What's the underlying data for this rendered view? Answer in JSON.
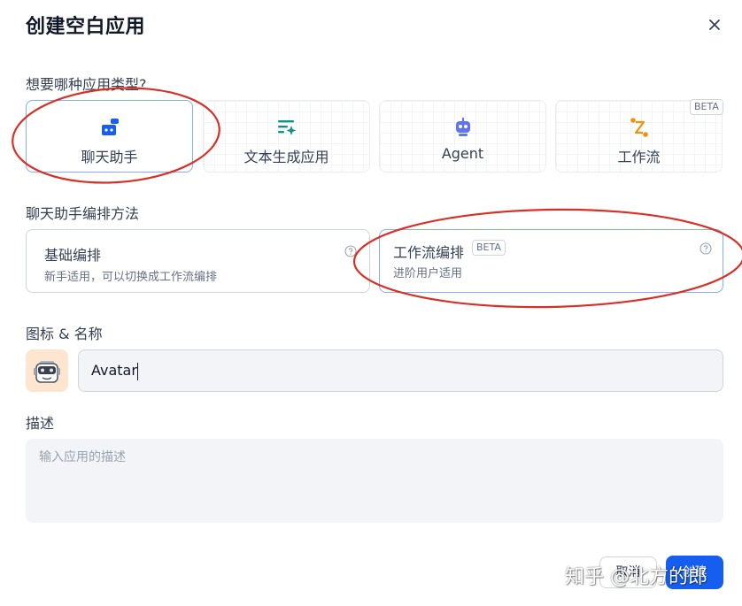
{
  "dialog": {
    "title": "创建空白应用"
  },
  "app_type": {
    "label": "想要哪种应用类型?",
    "options": [
      {
        "label": "聊天助手",
        "icon": "chat-bot-icon",
        "selected": true
      },
      {
        "label": "文本生成应用",
        "icon": "text-generator-icon"
      },
      {
        "label": "Agent",
        "icon": "agent-robot-icon"
      },
      {
        "label": "工作流",
        "icon": "workflow-icon",
        "badge": "BETA"
      }
    ]
  },
  "method": {
    "label": "聊天助手编排方法",
    "options": [
      {
        "title": "基础编排",
        "desc": "新手适用，可以切换成工作流编排"
      },
      {
        "title": "工作流编排",
        "badge": "BETA",
        "desc": "进阶用户适用",
        "selected": true
      }
    ]
  },
  "icon_name": {
    "label": "图标 & 名称",
    "value": "Avatar"
  },
  "description": {
    "label": "描述",
    "placeholder": "输入应用的描述"
  },
  "footer": {
    "cancel": "取消",
    "create": "创建"
  },
  "watermark": "知乎 @北方的郎",
  "colors": {
    "accent": "#155eef",
    "annotation": "#d93025",
    "avatar_bg": "#fde5cf"
  }
}
